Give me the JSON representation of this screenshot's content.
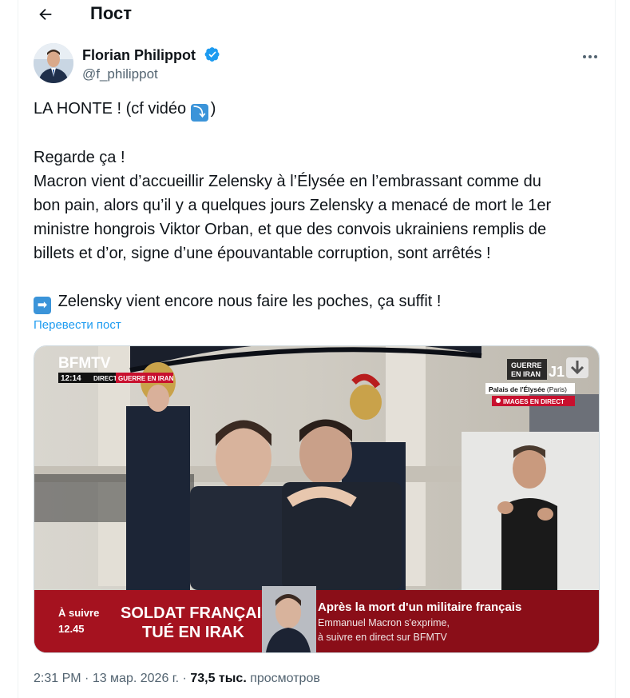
{
  "header": {
    "title": "Пост"
  },
  "author": {
    "name": "Florian Philippot",
    "handle": "@f_philippot"
  },
  "tweet": {
    "line1": "LA HONTE ! (cf vidéo ",
    "line1_emoji": "⤵",
    "line1_end": ")",
    "line2": "Regarde ça !",
    "line3": "Macron vient d’accueillir Zelensky à l’Élysée en l’embrassant comme du",
    "line4": "bon pain, alors qu’il y a quelques jours Zelensky a menacé de mort le 1er",
    "line5": "ministre hongrois Viktor Orban, et que des convois ukrainiens remplis de",
    "line6": "billets et d’or, signe d’une épouvantable corruption, sont arrêtés !",
    "line7_emoji": "➡",
    "line7": "Zelensky vient encore nous faire les poches, ça suffit !",
    "translate": "Перевести пост"
  },
  "video": {
    "logo": "BFMTV",
    "time": "12:14",
    "direct": "DIRECT",
    "tag": "GUERRE EN IRAN",
    "badge_line1": "GUERRE",
    "badge_line2": "EN IRAN",
    "badge_j": "J1",
    "location": "Palais de l'Élysée",
    "location_city": "(Paris)",
    "images_direct": "IMAGES EN DIRECT",
    "suivre": "À suivre",
    "suivre_time": "12.45",
    "headline1": "SOLDAT FRANÇAIS",
    "headline2": "TUÉ EN IRAK",
    "right_title": "Après la mort d'un militaire français",
    "right_sub1": "Emmanuel Macron s'exprime,",
    "right_sub2": "à suivre en direct sur BFMTV"
  },
  "meta": {
    "time": "2:31 PM",
    "date": "13 мар. 2026 г.",
    "views": "73,5 тыс.",
    "views_label": "просмотров"
  },
  "colors": {
    "accent": "#1d9bf0",
    "bfm_red": "#c8102e",
    "ticker_dark": "#7a0c14"
  }
}
